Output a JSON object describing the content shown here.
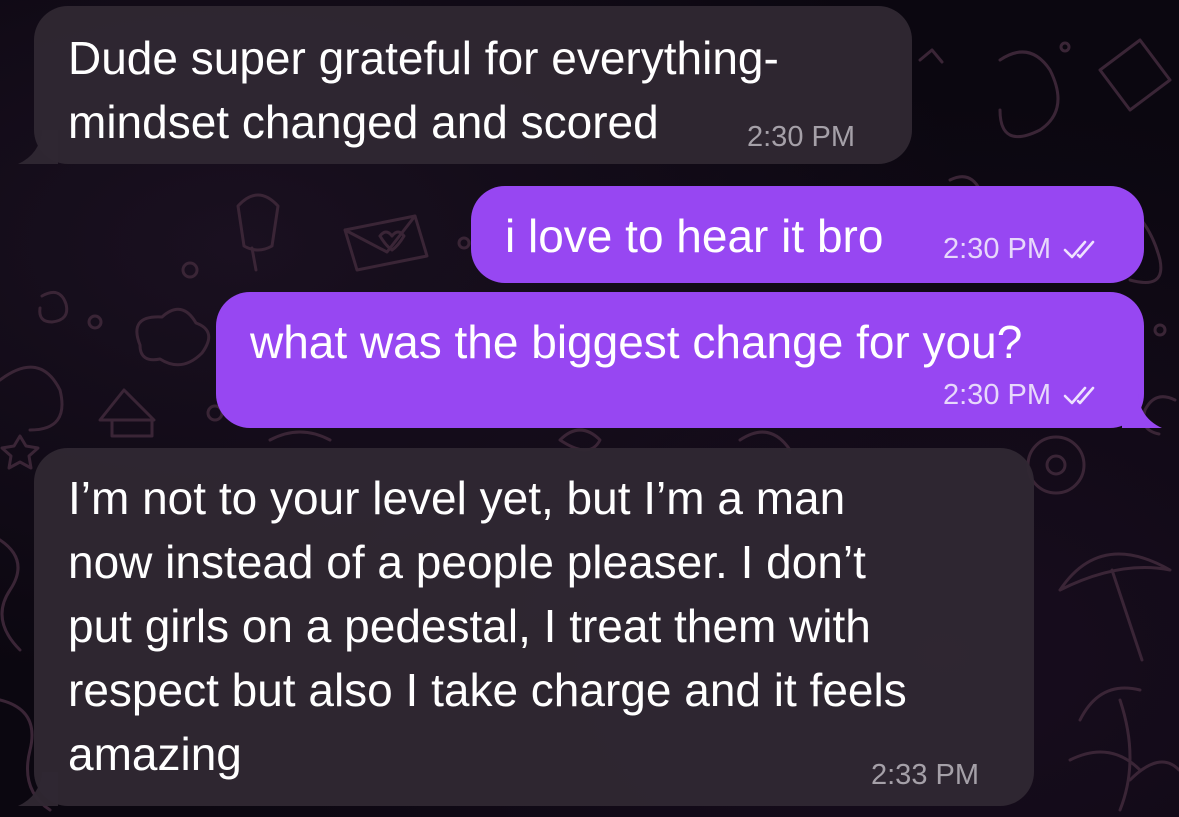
{
  "chat": {
    "messages": [
      {
        "direction": "incoming",
        "text": "Dude super grateful for everything-\nmindset changed and scored",
        "time": "2:30 PM"
      },
      {
        "direction": "outgoing",
        "text": "i love to hear it bro",
        "time": "2:30 PM",
        "status": "read-double-check-icon"
      },
      {
        "direction": "outgoing",
        "text": "what was the biggest change for you?",
        "time": "2:30 PM",
        "status": "read-double-check-icon"
      },
      {
        "direction": "incoming",
        "text": "I’m not to your level yet, but I’m a man\nnow instead of a people pleaser. I don’t\nput girls on a pedestal, I treat them with\nrespect but also I take charge and it feels\namazing",
        "time": "2:33 PM"
      }
    ]
  },
  "colors": {
    "background": "#0b0710",
    "incoming_bubble": "#302832",
    "outgoing_bubble": "#9747f2",
    "doodle_stroke": "#3a2536"
  }
}
